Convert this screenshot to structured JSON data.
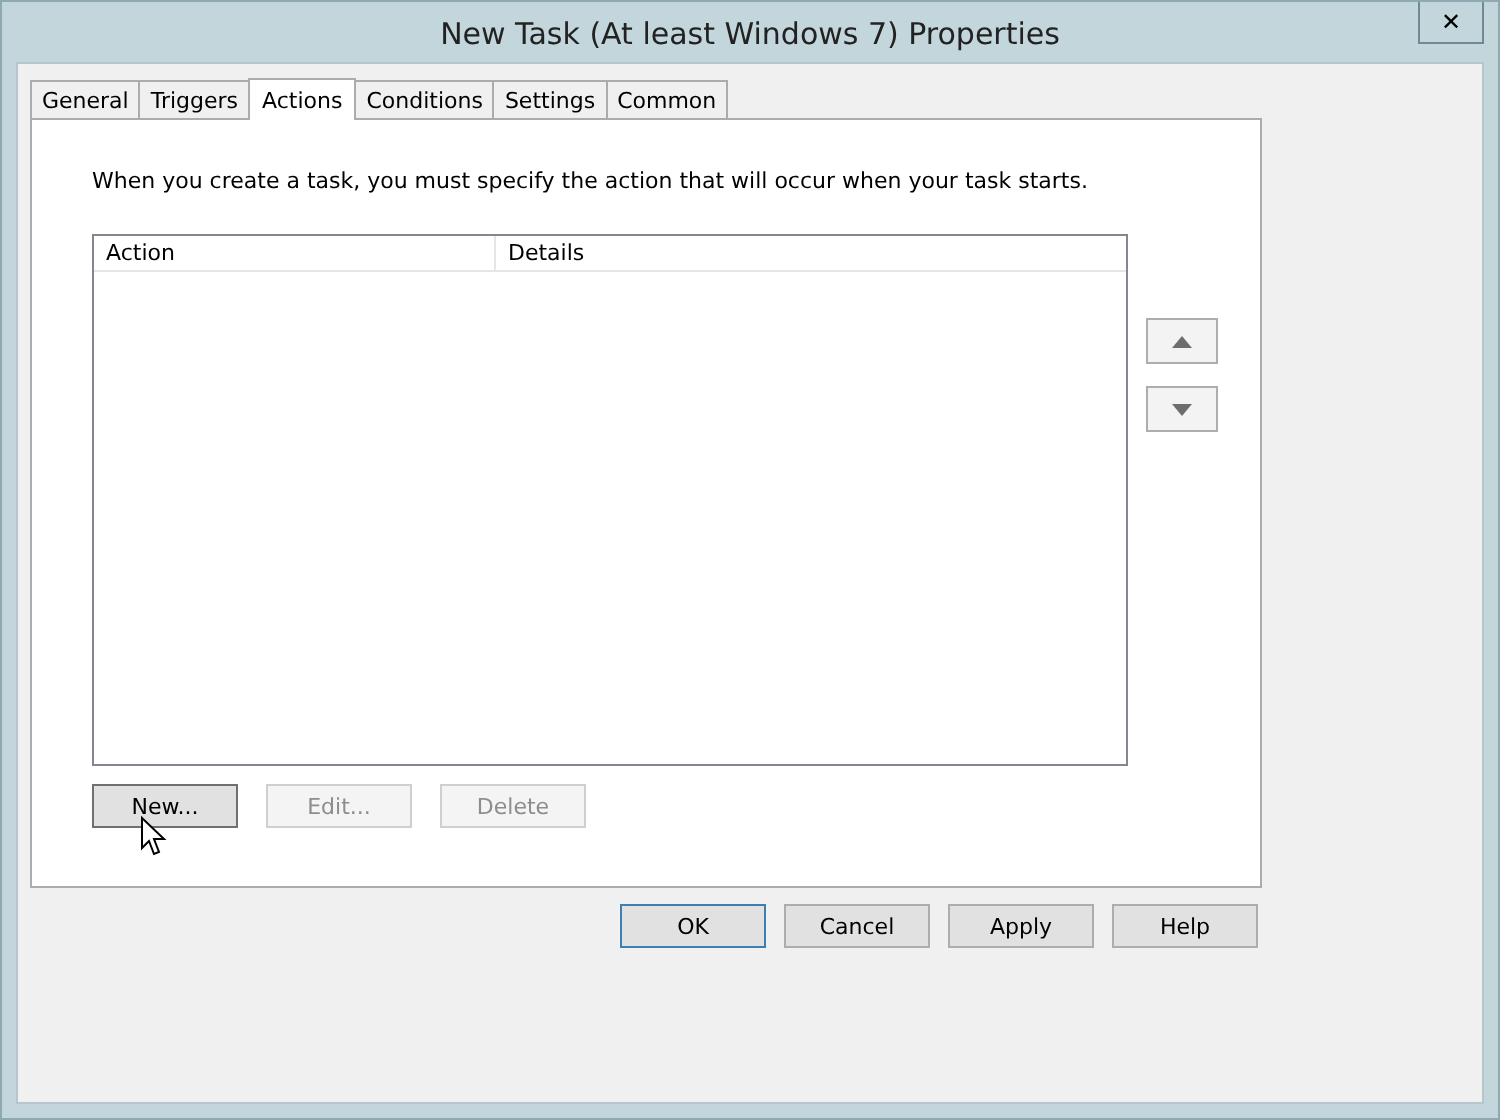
{
  "window": {
    "title": "New Task (At least Windows 7) Properties",
    "close": "✕"
  },
  "tabs": [
    {
      "label": "General",
      "selected": false
    },
    {
      "label": "Triggers",
      "selected": false
    },
    {
      "label": "Actions",
      "selected": true
    },
    {
      "label": "Conditions",
      "selected": false
    },
    {
      "label": "Settings",
      "selected": false
    },
    {
      "label": "Common",
      "selected": false
    }
  ],
  "description": "When you create a task, you must specify the action that will occur when your task starts.",
  "table": {
    "columns": [
      "Action",
      "Details"
    ]
  },
  "action_buttons": [
    {
      "label": "New...",
      "disabled": false
    },
    {
      "label": "Edit...",
      "disabled": true
    },
    {
      "label": "Delete",
      "disabled": true
    }
  ],
  "dialog_buttons": [
    {
      "label": "OK",
      "default": true
    },
    {
      "label": "Cancel",
      "default": false
    },
    {
      "label": "Apply",
      "default": false
    },
    {
      "label": "Help",
      "default": false
    }
  ]
}
